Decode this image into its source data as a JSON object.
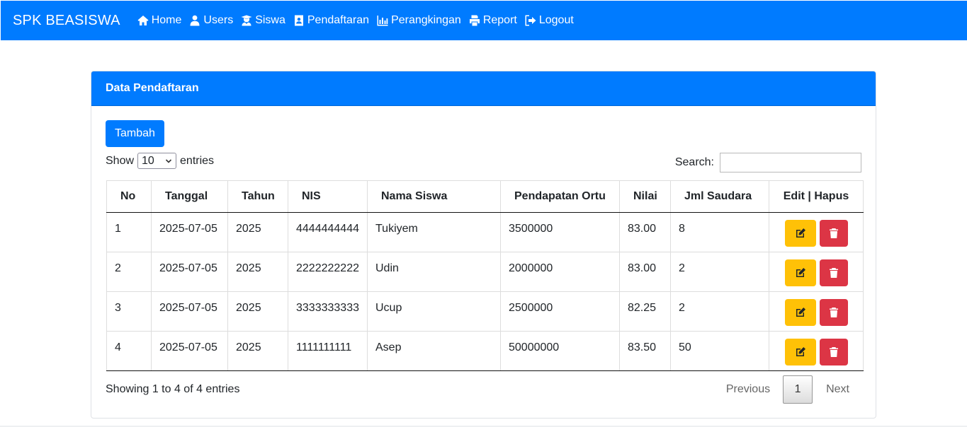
{
  "nav": {
    "brand": "SPK BEASISWA",
    "items": [
      {
        "label": "Home",
        "icon": "home-icon"
      },
      {
        "label": "Users",
        "icon": "user-icon"
      },
      {
        "label": "Siswa",
        "icon": "graduate-icon"
      },
      {
        "label": "Pendaftaran",
        "icon": "address-card-icon"
      },
      {
        "label": "Perangkingan",
        "icon": "bar-chart-icon"
      },
      {
        "label": "Report",
        "icon": "print-icon"
      },
      {
        "label": "Logout",
        "icon": "logout-icon"
      }
    ]
  },
  "card": {
    "title": "Data Pendaftaran",
    "add_label": "Tambah"
  },
  "table_controls": {
    "show_label": "Show",
    "entries_value": "10",
    "entries_label": "entries",
    "search_label": "Search:",
    "search_value": ""
  },
  "table": {
    "headers": [
      "No",
      "Tanggal",
      "Tahun",
      "NIS",
      "Nama Siswa",
      "Pendapatan Ortu",
      "Nilai",
      "Jml Saudara",
      "Edit | Hapus"
    ],
    "rows": [
      [
        "1",
        "2025-07-05",
        "2025",
        "4444444444",
        "Tukiyem",
        "3500000",
        "83.00",
        "8"
      ],
      [
        "2",
        "2025-07-05",
        "2025",
        "2222222222",
        "Udin",
        "2000000",
        "83.00",
        "2"
      ],
      [
        "3",
        "2025-07-05",
        "2025",
        "3333333333",
        "Ucup",
        "2500000",
        "82.25",
        "2"
      ],
      [
        "4",
        "2025-07-05",
        "2025",
        "1111111111",
        "Asep",
        "50000000",
        "83.50",
        "50"
      ]
    ]
  },
  "footer": {
    "info": "Showing 1 to 4 of 4 entries",
    "previous": "Previous",
    "page": "1",
    "next": "Next"
  },
  "colors": {
    "primary": "#007bff",
    "warning": "#ffc107",
    "danger": "#dc3545"
  }
}
